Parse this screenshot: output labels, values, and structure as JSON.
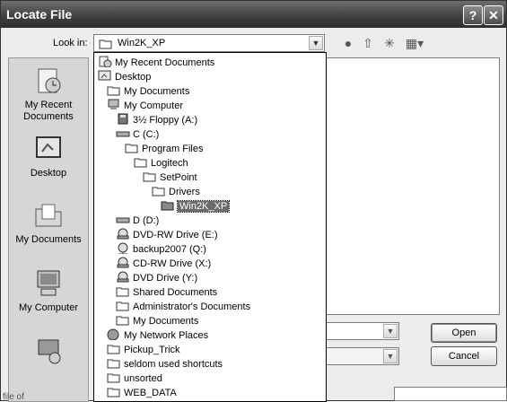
{
  "window": {
    "title": "Locate File",
    "help_glyph": "?",
    "close_glyph": "✕"
  },
  "lookin": {
    "label": "Look in:",
    "value": "Win2K_XP"
  },
  "places": [
    {
      "label_line1": "My Recent",
      "label_line2": "Documents",
      "icon": "recent-documents-icon"
    },
    {
      "label_line1": "Desktop",
      "label_line2": "",
      "icon": "desktop-icon"
    },
    {
      "label_line1": "My Documents",
      "label_line2": "",
      "icon": "my-documents-icon"
    },
    {
      "label_line1": "My Computer",
      "label_line2": "",
      "icon": "my-computer-icon"
    },
    {
      "label_line1": "",
      "label_line2": "",
      "icon": "network-icon"
    }
  ],
  "dropdown_items": [
    {
      "label": "My Recent Documents",
      "icon": "recent-documents-icon",
      "level": 0
    },
    {
      "label": "Desktop",
      "icon": "desktop-icon",
      "level": 0
    },
    {
      "label": "My Documents",
      "icon": "folder-icon",
      "level": 1
    },
    {
      "label": "My Computer",
      "icon": "computer-icon",
      "level": 1
    },
    {
      "label": "3½ Floppy (A:)",
      "icon": "floppy-icon",
      "level": 2
    },
    {
      "label": "C (C:)",
      "icon": "drive-icon",
      "level": 2
    },
    {
      "label": "Program Files",
      "icon": "folder-icon",
      "level": 3
    },
    {
      "label": "Logitech",
      "icon": "folder-icon",
      "level": 4
    },
    {
      "label": "SetPoint",
      "icon": "folder-icon",
      "level": 5
    },
    {
      "label": "Drivers",
      "icon": "folder-icon",
      "level": 6
    },
    {
      "label": "Win2K_XP",
      "icon": "folder-open-icon",
      "level": 7,
      "selected": true
    },
    {
      "label": "D (D:)",
      "icon": "drive-icon",
      "level": 2
    },
    {
      "label": "DVD-RW Drive (E:)",
      "icon": "cd-drive-icon",
      "level": 2
    },
    {
      "label": "backup2007 (Q:)",
      "icon": "network-drive-icon",
      "level": 2
    },
    {
      "label": "CD-RW Drive (X:)",
      "icon": "cd-drive-icon",
      "level": 2
    },
    {
      "label": "DVD Drive (Y:)",
      "icon": "cd-drive-icon",
      "level": 2
    },
    {
      "label": "Shared Documents",
      "icon": "folder-icon",
      "level": 2
    },
    {
      "label": "Administrator's Documents",
      "icon": "folder-icon",
      "level": 2
    },
    {
      "label": "My Documents",
      "icon": "folder-icon",
      "level": 2
    },
    {
      "label": "My Network Places",
      "icon": "network-icon",
      "level": 1
    },
    {
      "label": "Pickup_Trick",
      "icon": "folder-icon",
      "level": 1
    },
    {
      "label": "seldom used shortcuts",
      "icon": "folder-icon",
      "level": 1
    },
    {
      "label": "unsorted",
      "icon": "folder-icon",
      "level": 1
    },
    {
      "label": "WEB_DATA",
      "icon": "folder-icon",
      "level": 1
    }
  ],
  "buttons": {
    "open": "Open",
    "cancel": "Cancel"
  },
  "bottom_label": "file of"
}
